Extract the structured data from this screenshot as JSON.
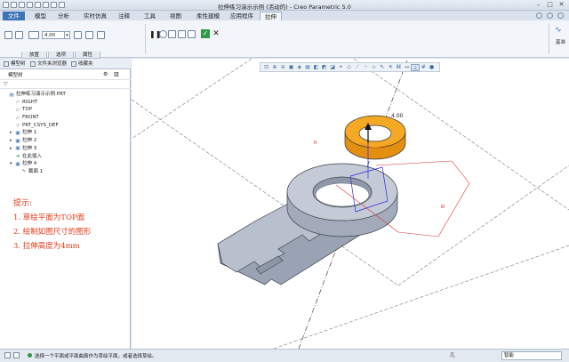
{
  "window": {
    "title": "拉伸练习演示示例 (活动的) - Creo Parametric 5.0"
  },
  "menu": {
    "file": "文件",
    "tabs": [
      "模型",
      "分析",
      "实时仿真",
      "注释",
      "工具",
      "视图",
      "柔性建模",
      "应用程序"
    ],
    "active_tab": "拉伸"
  },
  "ribbon": {
    "depth_value": "4.00",
    "views_label": "基准",
    "subtabs": [
      "放置",
      "选项",
      "属性"
    ]
  },
  "panel": {
    "tabs": [
      "模型树",
      "文件夹浏览器",
      "收藏夹"
    ],
    "tree_label": "模型树",
    "tree": [
      {
        "label": "拉伸练习演示示例.PRT",
        "level": 0,
        "expander": "",
        "icon": "part-icon"
      },
      {
        "label": "RIGHT",
        "level": 1,
        "expander": "",
        "icon": "datum-plane-icon"
      },
      {
        "label": "TOP",
        "level": 1,
        "expander": "",
        "icon": "datum-plane-icon"
      },
      {
        "label": "FRONT",
        "level": 1,
        "expander": "",
        "icon": "datum-plane-icon"
      },
      {
        "label": "PRT_CSYS_DEF",
        "level": 1,
        "expander": "",
        "icon": "csys-icon"
      },
      {
        "label": "拉伸 1",
        "level": 1,
        "expander": "▸",
        "icon": "extrude-icon"
      },
      {
        "label": "拉伸 2",
        "level": 1,
        "expander": "▸",
        "icon": "extrude-icon"
      },
      {
        "label": "拉伸 3",
        "level": 1,
        "expander": "▸",
        "icon": "extrude-icon"
      },
      {
        "label": "在此插入",
        "level": 1,
        "expander": "",
        "icon": "insert-here-icon"
      },
      {
        "label": "拉伸 4",
        "level": 1,
        "expander": "▾",
        "icon": "extrude-icon"
      },
      {
        "label": "截面 1",
        "level": 2,
        "expander": "",
        "icon": "sketch-icon"
      }
    ]
  },
  "hint": {
    "title": "提示:",
    "lines": [
      "1. 草绘平面为TOP面",
      "2. 绘制如图尺寸的图形",
      "3. 拉伸高度为4mm"
    ]
  },
  "viewport": {
    "dimension_label": "4.00",
    "dimension_small_a": "R",
    "dimension_small_b": "Ø"
  },
  "status": {
    "message": "选择一个平面或平面曲面作为草绘平面，或者选择草绘。",
    "selection": "几",
    "filter_value": "智能"
  },
  "colors": {
    "model_gray": "#aeb6c4",
    "feature_orange": "#f2a01c",
    "hint_red": "#e03a1a",
    "file_tab_blue": "#3d74b5"
  }
}
